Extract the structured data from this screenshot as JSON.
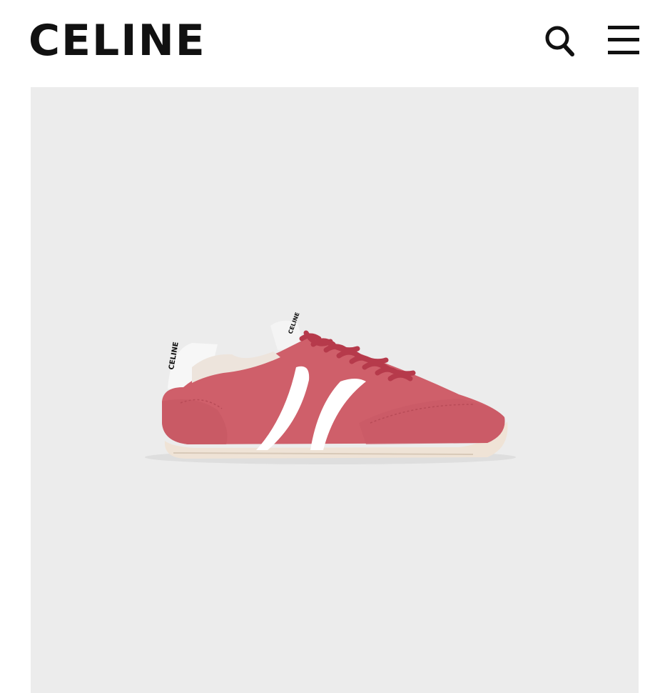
{
  "header": {
    "logo_text": "CELINE",
    "search_icon": "search-icon",
    "menu_icon": "hamburger-menu-icon"
  },
  "product": {
    "image_subject": "sneaker",
    "shoe_logo_text": "CELINE",
    "colors": {
      "suede": "#cf5f6a",
      "laces": "#b63a4b",
      "stripe": "#ffffff",
      "sole": "#efe3d6",
      "background": "#ececec"
    }
  }
}
